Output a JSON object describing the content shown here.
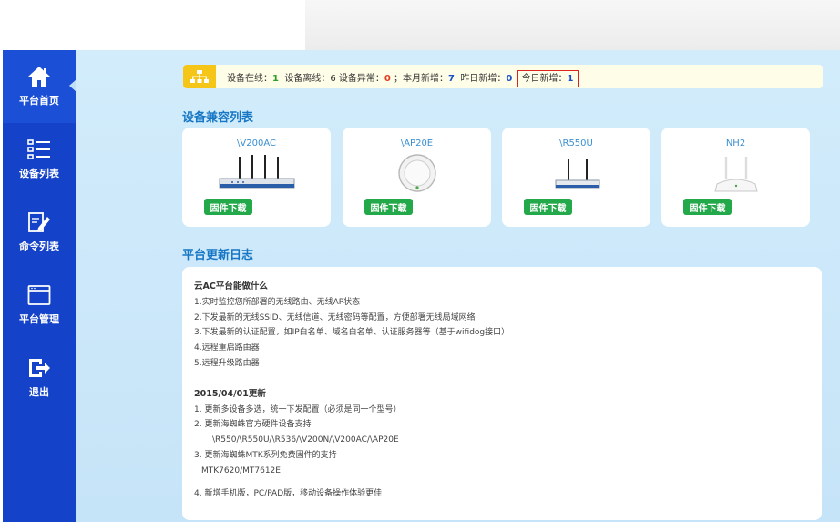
{
  "sidebar": {
    "items": [
      {
        "label": "平台首页",
        "icon": "home-icon"
      },
      {
        "label": "设备列表",
        "icon": "list-icon"
      },
      {
        "label": "命令列表",
        "icon": "edit-icon"
      },
      {
        "label": "平台管理",
        "icon": "window-icon"
      },
      {
        "label": "退出",
        "icon": "logout-icon"
      }
    ]
  },
  "status": {
    "online_label": "设备在线：",
    "online_value": "1",
    "offline_label": "设备离线：6",
    "abnormal_label": "设备异常：",
    "abnormal_value": "0",
    "sep": "；",
    "month_label": "本月新增：",
    "month_value": "7",
    "yesterday_label": "昨日新增：",
    "yesterday_value": "0",
    "today_label": "今日新增：",
    "today_value": "1"
  },
  "devices_title": "设备兼容列表",
  "devices": [
    {
      "model": "\\V200AC",
      "download": "固件下载"
    },
    {
      "model": "\\AP20E",
      "download": "固件下载"
    },
    {
      "model": "\\R550U",
      "download": "固件下载"
    },
    {
      "model": "NH2",
      "download": "固件下载"
    }
  ],
  "log_title": "平台更新日志",
  "log": {
    "intro_title": "云AC平台能做什么",
    "intro_items": [
      "1.实时监控您所部署的无线路由、无线AP状态",
      "2.下发最新的无线SSID、无线信道、无线密码等配置，方便部署无线局域网络",
      "3.下发最新的认证配置，如IP白名单、域名白名单、认证服务器等（基于wifidog接口）",
      "4.远程重启路由器",
      "5.远程升级路由器"
    ],
    "update_title": "2015/04/01更新",
    "update_items": [
      "1. 更新多设备多选，统一下发配置（必须是同一个型号）",
      "2. 更新海蜘蛛官方硬件设备支持",
      "\\R550/\\R550U/\\R536/\\V200N/\\V200AC/\\AP20E",
      "3. 更新海蜘蛛MTK系列免费固件的支持",
      "MTK7620/MT7612E",
      "4. 新增手机版，PC/PAD版，移动设备操作体验更佳"
    ]
  },
  "colors": {
    "sidebar": "#1442c8",
    "main_bg": "#c9e6f9",
    "accent_title": "#1777c5",
    "download_btn": "#23a84a"
  }
}
